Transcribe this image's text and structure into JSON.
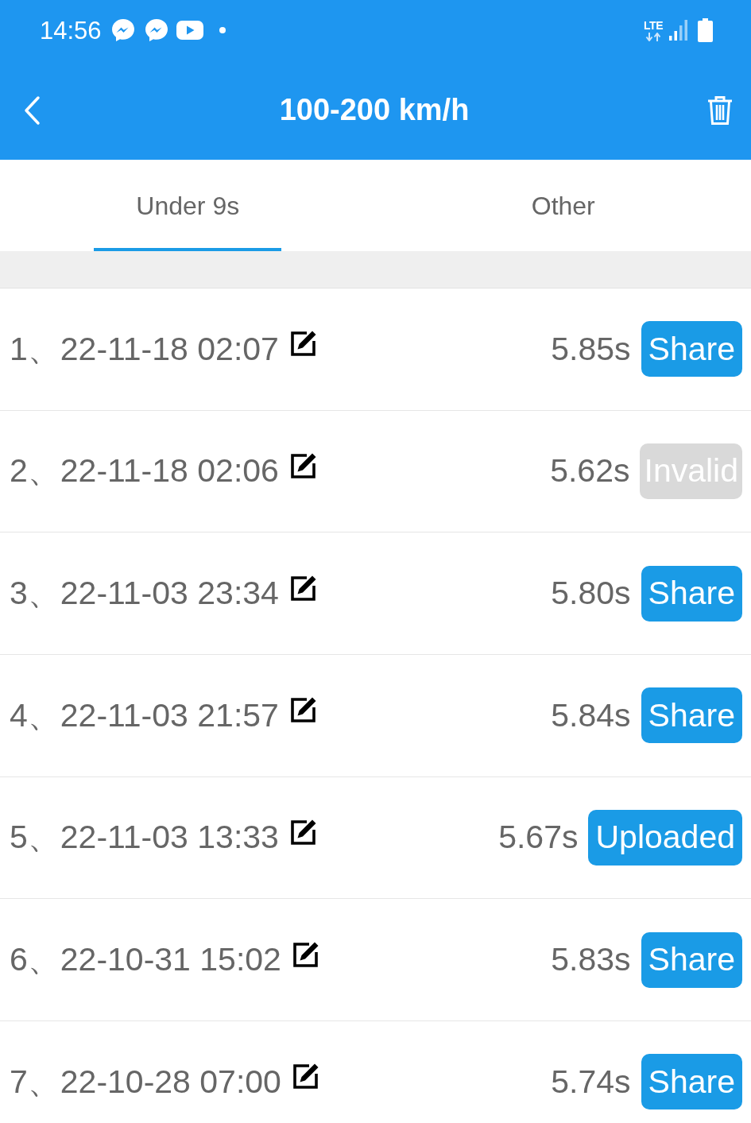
{
  "status_bar": {
    "time": "14:56",
    "network": "LTE"
  },
  "app_bar": {
    "title": "100-200 km/h"
  },
  "tabs": [
    {
      "label": "Under 9s",
      "selected": true
    },
    {
      "label": "Other",
      "selected": false
    }
  ],
  "records": [
    {
      "label": "1、22-11-18 02:07",
      "time": "5.85s",
      "action": {
        "label": "Share",
        "disabled": false
      }
    },
    {
      "label": "2、22-11-18 02:06",
      "time": "5.62s",
      "action": {
        "label": "Invalid",
        "disabled": true
      }
    },
    {
      "label": "3、22-11-03 23:34",
      "time": "5.80s",
      "action": {
        "label": "Share",
        "disabled": false
      }
    },
    {
      "label": "4、22-11-03 21:57",
      "time": "5.84s",
      "action": {
        "label": "Share",
        "disabled": false
      }
    },
    {
      "label": "5、22-11-03 13:33",
      "time": "5.67s",
      "action": {
        "label": "Uploaded",
        "disabled": false
      }
    },
    {
      "label": "6、22-10-31 15:02",
      "time": "5.83s",
      "action": {
        "label": "Share",
        "disabled": false
      }
    },
    {
      "label": "7、22-10-28 07:00",
      "time": "5.74s",
      "action": {
        "label": "Share",
        "disabled": false
      }
    }
  ]
}
